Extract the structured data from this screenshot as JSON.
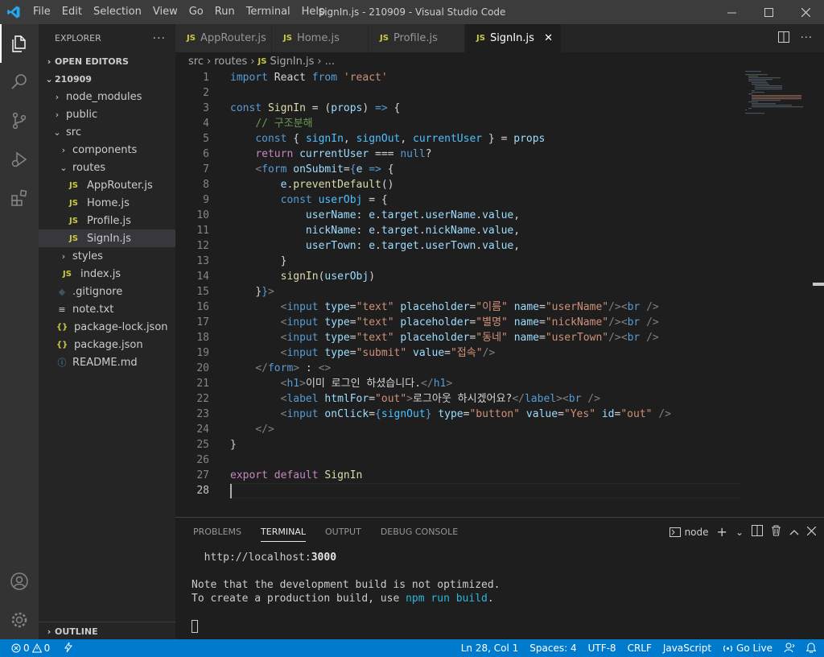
{
  "window": {
    "title": "SignIn.js - 210909 - Visual Studio Code",
    "menu": [
      "File",
      "Edit",
      "Selection",
      "View",
      "Go",
      "Run",
      "Terminal",
      "Help"
    ]
  },
  "activity": [
    "files-icon",
    "search-icon",
    "source-control-icon",
    "run-debug-icon",
    "extensions-icon"
  ],
  "explorer": {
    "header": "EXPLORER",
    "open_editors": "OPEN EDITORS",
    "root": "210909",
    "items": [
      {
        "label": "node_modules",
        "type": "folder",
        "depth": 1,
        "open": false
      },
      {
        "label": "public",
        "type": "folder",
        "depth": 1,
        "open": false
      },
      {
        "label": "src",
        "type": "folder",
        "depth": 1,
        "open": true
      },
      {
        "label": "components",
        "type": "folder",
        "depth": 2,
        "open": false
      },
      {
        "label": "routes",
        "type": "folder",
        "depth": 2,
        "open": true
      },
      {
        "label": "AppRouter.js",
        "type": "js",
        "depth": 3
      },
      {
        "label": "Home.js",
        "type": "js",
        "depth": 3
      },
      {
        "label": "Profile.js",
        "type": "js",
        "depth": 3
      },
      {
        "label": "SignIn.js",
        "type": "js",
        "depth": 3,
        "selected": true
      },
      {
        "label": "styles",
        "type": "folder",
        "depth": 2,
        "open": false
      },
      {
        "label": "index.js",
        "type": "js",
        "depth": 2
      },
      {
        "label": ".gitignore",
        "type": "git",
        "depth": 1
      },
      {
        "label": "note.txt",
        "type": "txt",
        "depth": 1
      },
      {
        "label": "package-lock.json",
        "type": "json",
        "depth": 1
      },
      {
        "label": "package.json",
        "type": "json",
        "depth": 1
      },
      {
        "label": "README.md",
        "type": "info",
        "depth": 1
      }
    ],
    "outline": "OUTLINE"
  },
  "tabs": [
    {
      "label": "AppRouter.js",
      "active": false
    },
    {
      "label": "Home.js",
      "active": false
    },
    {
      "label": "Profile.js",
      "active": false
    },
    {
      "label": "SignIn.js",
      "active": true
    }
  ],
  "breadcrumbs": [
    "src",
    "routes",
    "SignIn.js",
    "..."
  ],
  "breadcrumb_js": "JS",
  "editor": {
    "lines": [
      [
        [
          "k",
          "import"
        ],
        [
          "p",
          " React "
        ],
        [
          "k",
          "from"
        ],
        [
          "p",
          " "
        ],
        [
          "s",
          "'react'"
        ]
      ],
      [],
      [
        [
          "k",
          "const"
        ],
        [
          "p",
          " "
        ],
        [
          "f",
          "SignIn"
        ],
        [
          "p",
          " = ("
        ],
        [
          "v",
          "props"
        ],
        [
          "p",
          ") "
        ],
        [
          "k",
          "=>"
        ],
        [
          "p",
          " {"
        ]
      ],
      [
        [
          "p",
          "    "
        ],
        [
          "cm",
          "// 구조분해"
        ]
      ],
      [
        [
          "p",
          "    "
        ],
        [
          "k",
          "const"
        ],
        [
          "p",
          " { "
        ],
        [
          "cl",
          "signIn"
        ],
        [
          "p",
          ", "
        ],
        [
          "cl",
          "signOut"
        ],
        [
          "p",
          ", "
        ],
        [
          "cl",
          "currentUser"
        ],
        [
          "p",
          " } = "
        ],
        [
          "v",
          "props"
        ]
      ],
      [
        [
          "p",
          "    "
        ],
        [
          "c",
          "return"
        ],
        [
          "p",
          " "
        ],
        [
          "v",
          "currentUser"
        ],
        [
          "p",
          " === "
        ],
        [
          "k",
          "null"
        ],
        [
          "p",
          "?"
        ]
      ],
      [
        [
          "p",
          "    "
        ],
        [
          "g",
          "<"
        ],
        [
          "k",
          "form"
        ],
        [
          "p",
          " "
        ],
        [
          "v",
          "onSubmit"
        ],
        [
          "p",
          "="
        ],
        [
          "k",
          "{"
        ],
        [
          "v",
          "e"
        ],
        [
          "p",
          " "
        ],
        [
          "k",
          "=>"
        ],
        [
          "p",
          " {"
        ]
      ],
      [
        [
          "p",
          "        "
        ],
        [
          "v",
          "e"
        ],
        [
          "p",
          "."
        ],
        [
          "f",
          "preventDefault"
        ],
        [
          "p",
          "()"
        ]
      ],
      [
        [
          "p",
          "        "
        ],
        [
          "k",
          "const"
        ],
        [
          "p",
          " "
        ],
        [
          "cl",
          "userObj"
        ],
        [
          "p",
          " = {"
        ]
      ],
      [
        [
          "p",
          "            "
        ],
        [
          "v",
          "userName"
        ],
        [
          "p",
          ": "
        ],
        [
          "v",
          "e"
        ],
        [
          "p",
          "."
        ],
        [
          "v",
          "target"
        ],
        [
          "p",
          "."
        ],
        [
          "v",
          "userName"
        ],
        [
          "p",
          "."
        ],
        [
          "v",
          "value"
        ],
        [
          "p",
          ","
        ]
      ],
      [
        [
          "p",
          "            "
        ],
        [
          "v",
          "nickName"
        ],
        [
          "p",
          ": "
        ],
        [
          "v",
          "e"
        ],
        [
          "p",
          "."
        ],
        [
          "v",
          "target"
        ],
        [
          "p",
          "."
        ],
        [
          "v",
          "nickName"
        ],
        [
          "p",
          "."
        ],
        [
          "v",
          "value"
        ],
        [
          "p",
          ","
        ]
      ],
      [
        [
          "p",
          "            "
        ],
        [
          "v",
          "userTown"
        ],
        [
          "p",
          ": "
        ],
        [
          "v",
          "e"
        ],
        [
          "p",
          "."
        ],
        [
          "v",
          "target"
        ],
        [
          "p",
          "."
        ],
        [
          "v",
          "userTown"
        ],
        [
          "p",
          "."
        ],
        [
          "v",
          "value"
        ],
        [
          "p",
          ","
        ]
      ],
      [
        [
          "p",
          "        }"
        ]
      ],
      [
        [
          "p",
          "        "
        ],
        [
          "f",
          "signIn"
        ],
        [
          "p",
          "("
        ],
        [
          "v",
          "userObj"
        ],
        [
          "p",
          ")"
        ]
      ],
      [
        [
          "p",
          "    "
        ],
        [
          "p",
          "}"
        ],
        [
          "k",
          "}"
        ],
        [
          "g",
          ">"
        ]
      ],
      [
        [
          "p",
          "        "
        ],
        [
          "g",
          "<"
        ],
        [
          "k",
          "input"
        ],
        [
          "p",
          " "
        ],
        [
          "v",
          "type"
        ],
        [
          "p",
          "="
        ],
        [
          "s",
          "\"text\""
        ],
        [
          "p",
          " "
        ],
        [
          "v",
          "placeholder"
        ],
        [
          "p",
          "="
        ],
        [
          "s",
          "\"이름\""
        ],
        [
          "p",
          " "
        ],
        [
          "v",
          "name"
        ],
        [
          "p",
          "="
        ],
        [
          "s",
          "\"userName\""
        ],
        [
          "g",
          "/><"
        ],
        [
          "k",
          "br"
        ],
        [
          "p",
          " "
        ],
        [
          "g",
          "/>"
        ]
      ],
      [
        [
          "p",
          "        "
        ],
        [
          "g",
          "<"
        ],
        [
          "k",
          "input"
        ],
        [
          "p",
          " "
        ],
        [
          "v",
          "type"
        ],
        [
          "p",
          "="
        ],
        [
          "s",
          "\"text\""
        ],
        [
          "p",
          " "
        ],
        [
          "v",
          "placeholder"
        ],
        [
          "p",
          "="
        ],
        [
          "s",
          "\"별명\""
        ],
        [
          "p",
          " "
        ],
        [
          "v",
          "name"
        ],
        [
          "p",
          "="
        ],
        [
          "s",
          "\"nickName\""
        ],
        [
          "g",
          "/><"
        ],
        [
          "k",
          "br"
        ],
        [
          "p",
          " "
        ],
        [
          "g",
          "/>"
        ]
      ],
      [
        [
          "p",
          "        "
        ],
        [
          "g",
          "<"
        ],
        [
          "k",
          "input"
        ],
        [
          "p",
          " "
        ],
        [
          "v",
          "type"
        ],
        [
          "p",
          "="
        ],
        [
          "s",
          "\"text\""
        ],
        [
          "p",
          " "
        ],
        [
          "v",
          "placeholder"
        ],
        [
          "p",
          "="
        ],
        [
          "s",
          "\"동네\""
        ],
        [
          "p",
          " "
        ],
        [
          "v",
          "name"
        ],
        [
          "p",
          "="
        ],
        [
          "s",
          "\"userTown\""
        ],
        [
          "g",
          "/><"
        ],
        [
          "k",
          "br"
        ],
        [
          "p",
          " "
        ],
        [
          "g",
          "/>"
        ]
      ],
      [
        [
          "p",
          "        "
        ],
        [
          "g",
          "<"
        ],
        [
          "k",
          "input"
        ],
        [
          "p",
          " "
        ],
        [
          "v",
          "type"
        ],
        [
          "p",
          "="
        ],
        [
          "s",
          "\"submit\""
        ],
        [
          "p",
          " "
        ],
        [
          "v",
          "value"
        ],
        [
          "p",
          "="
        ],
        [
          "s",
          "\"접속\""
        ],
        [
          "g",
          "/>"
        ]
      ],
      [
        [
          "p",
          "    "
        ],
        [
          "g",
          "</"
        ],
        [
          "k",
          "form"
        ],
        [
          "g",
          ">"
        ],
        [
          "p",
          " : "
        ],
        [
          "g",
          "<>"
        ]
      ],
      [
        [
          "p",
          "        "
        ],
        [
          "g",
          "<"
        ],
        [
          "k",
          "h1"
        ],
        [
          "g",
          ">"
        ],
        [
          "p",
          "이미 로그인 하셨습니다."
        ],
        [
          "g",
          "</"
        ],
        [
          "k",
          "h1"
        ],
        [
          "g",
          ">"
        ]
      ],
      [
        [
          "p",
          "        "
        ],
        [
          "g",
          "<"
        ],
        [
          "k",
          "label"
        ],
        [
          "p",
          " "
        ],
        [
          "v",
          "htmlFor"
        ],
        [
          "p",
          "="
        ],
        [
          "s",
          "\"out\""
        ],
        [
          "g",
          ">"
        ],
        [
          "p",
          "로그아웃 하시겠어요?"
        ],
        [
          "g",
          "</"
        ],
        [
          "k",
          "label"
        ],
        [
          "g",
          "><"
        ],
        [
          "k",
          "br"
        ],
        [
          "p",
          " "
        ],
        [
          "g",
          "/>"
        ]
      ],
      [
        [
          "p",
          "        "
        ],
        [
          "g",
          "<"
        ],
        [
          "k",
          "input"
        ],
        [
          "p",
          " "
        ],
        [
          "v",
          "onClick"
        ],
        [
          "p",
          "="
        ],
        [
          "k",
          "{"
        ],
        [
          "cl",
          "signOut"
        ],
        [
          "k",
          "}"
        ],
        [
          "p",
          " "
        ],
        [
          "v",
          "type"
        ],
        [
          "p",
          "="
        ],
        [
          "s",
          "\"button\""
        ],
        [
          "p",
          " "
        ],
        [
          "v",
          "value"
        ],
        [
          "p",
          "="
        ],
        [
          "s",
          "\"Yes\""
        ],
        [
          "p",
          " "
        ],
        [
          "v",
          "id"
        ],
        [
          "p",
          "="
        ],
        [
          "s",
          "\"out\""
        ],
        [
          "p",
          " "
        ],
        [
          "g",
          "/>"
        ]
      ],
      [
        [
          "p",
          "    "
        ],
        [
          "g",
          "</>"
        ]
      ],
      [
        [
          "p",
          "}"
        ]
      ],
      [],
      [
        [
          "c",
          "export"
        ],
        [
          "p",
          " "
        ],
        [
          "c",
          "default"
        ],
        [
          "p",
          " "
        ],
        [
          "f",
          "SignIn"
        ]
      ],
      []
    ]
  },
  "panel": {
    "tabs": [
      "PROBLEMS",
      "TERMINAL",
      "OUTPUT",
      "DEBUG CONSOLE"
    ],
    "active": "TERMINAL",
    "shell": "node",
    "terminal": {
      "url_prefix": "  http://localhost:",
      "port": "3000",
      "note1": "Note that the development build is not optimized.",
      "note2_prefix": "To create a production build, use ",
      "note2_cmd": "npm run build",
      "note2_suffix": "."
    }
  },
  "status": {
    "errors": "0",
    "warnings": "0",
    "position": "Ln 28, Col 1",
    "spaces": "Spaces: 4",
    "encoding": "UTF-8",
    "eol": "CRLF",
    "language": "JavaScript",
    "golive": "Go Live"
  }
}
